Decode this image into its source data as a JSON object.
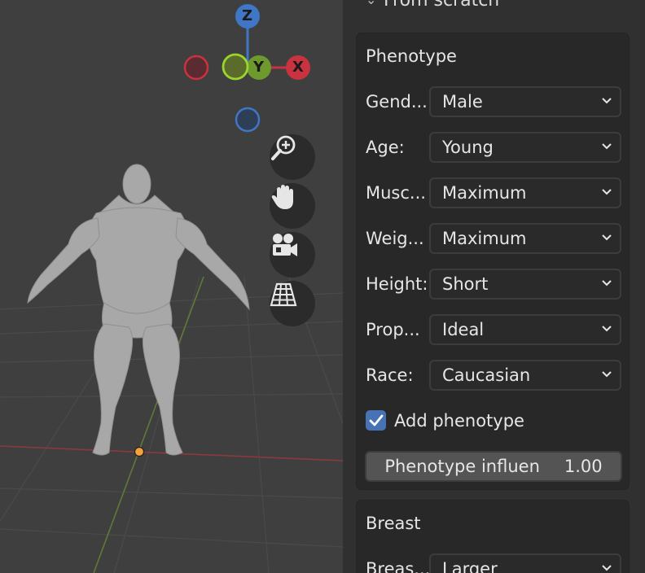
{
  "viewport": {
    "gizmo": {
      "z_label": "Z",
      "x_label": "X",
      "y_label": "Y"
    },
    "tools": [
      {
        "name": "zoom-icon"
      },
      {
        "name": "hand-pan-icon"
      },
      {
        "name": "camera-icon"
      },
      {
        "name": "perspective-grid-icon"
      }
    ],
    "colors": {
      "x_axis": "#c8333f",
      "y_axis": "#6e9a2d",
      "z_axis": "#3f76c6",
      "origin": "#f2a33a"
    }
  },
  "sidebar": {
    "top_header": "From scratch",
    "phenotype": {
      "title": "Phenotype",
      "rows": [
        {
          "label": "Gend...",
          "value": "Male"
        },
        {
          "label": "Age:",
          "value": "Young"
        },
        {
          "label": "Musc...",
          "value": "Maximum"
        },
        {
          "label": "Weig...",
          "value": "Maximum"
        },
        {
          "label": "Height:",
          "value": "Short"
        },
        {
          "label": "Prop...",
          "value": "Ideal"
        },
        {
          "label": "Race:",
          "value": "Caucasian"
        }
      ],
      "add_phenotype": {
        "label": "Add phenotype",
        "checked": true
      },
      "influence": {
        "label": "Phenotype influen",
        "value": "1.00"
      }
    },
    "breast": {
      "title": "Breast",
      "rows": [
        {
          "label": "Breas...",
          "value": "Larger"
        }
      ]
    }
  }
}
